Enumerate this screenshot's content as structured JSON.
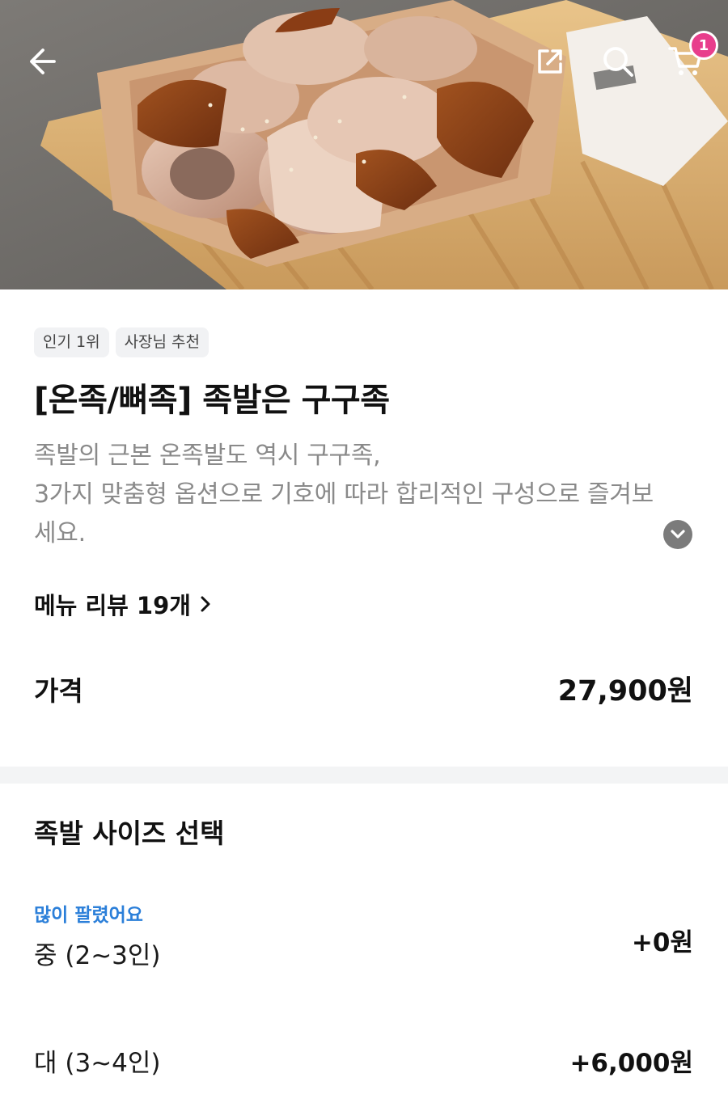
{
  "header": {
    "cart_count": "1"
  },
  "product": {
    "tags": [
      "인기 1위",
      "사장님 추천"
    ],
    "title": "[온족/뼈족] 족발은 구구족",
    "description_lines": [
      "족발의 근본 온족발도 역시 구구족,",
      "3가지 맞춤형 옵션으로 기호에 따라 합리적인 구성으로 즐겨보",
      "세요."
    ],
    "review_label": "메뉴 리뷰 19개",
    "price_label": "가격",
    "price_value": "27,900원"
  },
  "options": {
    "section_title": "족발 사이즈 선택",
    "items": [
      {
        "badge": "많이 팔렸어요",
        "label": "중 (2~3인)",
        "price": "+0원"
      },
      {
        "badge": "",
        "label": "대 (3~4인)",
        "price": "+6,000원"
      }
    ]
  },
  "colors": {
    "accent_blue": "#2b7fd9",
    "badge_pink": "#e83e8c",
    "divider": "#f3f4f5"
  },
  "icons": [
    "back-arrow-icon",
    "share-icon",
    "search-icon",
    "cart-icon",
    "chevron-down-icon",
    "chevron-right-icon"
  ]
}
